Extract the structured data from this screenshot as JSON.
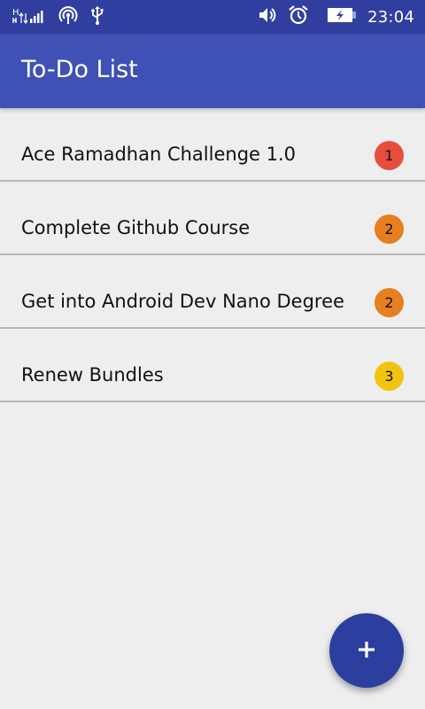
{
  "status_bar": {
    "time": "23:04",
    "icons": [
      "signal-h-icon",
      "hotspot-icon",
      "usb-icon",
      "volume-icon",
      "alarm-icon",
      "battery-charging-icon"
    ],
    "background": "#303f9f"
  },
  "app_bar": {
    "title": "To-Do List",
    "background": "#3f51b5"
  },
  "todos": [
    {
      "title": "Ace Ramadhan Challenge 1.0",
      "priority": "1",
      "color": "#e74c3c"
    },
    {
      "title": "Complete Github Course",
      "priority": "2",
      "color": "#e67e22"
    },
    {
      "title": "Get into Android Dev Nano Degree",
      "priority": "2",
      "color": "#e67e22"
    },
    {
      "title": "Renew Bundles",
      "priority": "3",
      "color": "#f1c40f"
    }
  ],
  "fab": {
    "icon": "plus-icon",
    "color": "#2c3e9e"
  }
}
